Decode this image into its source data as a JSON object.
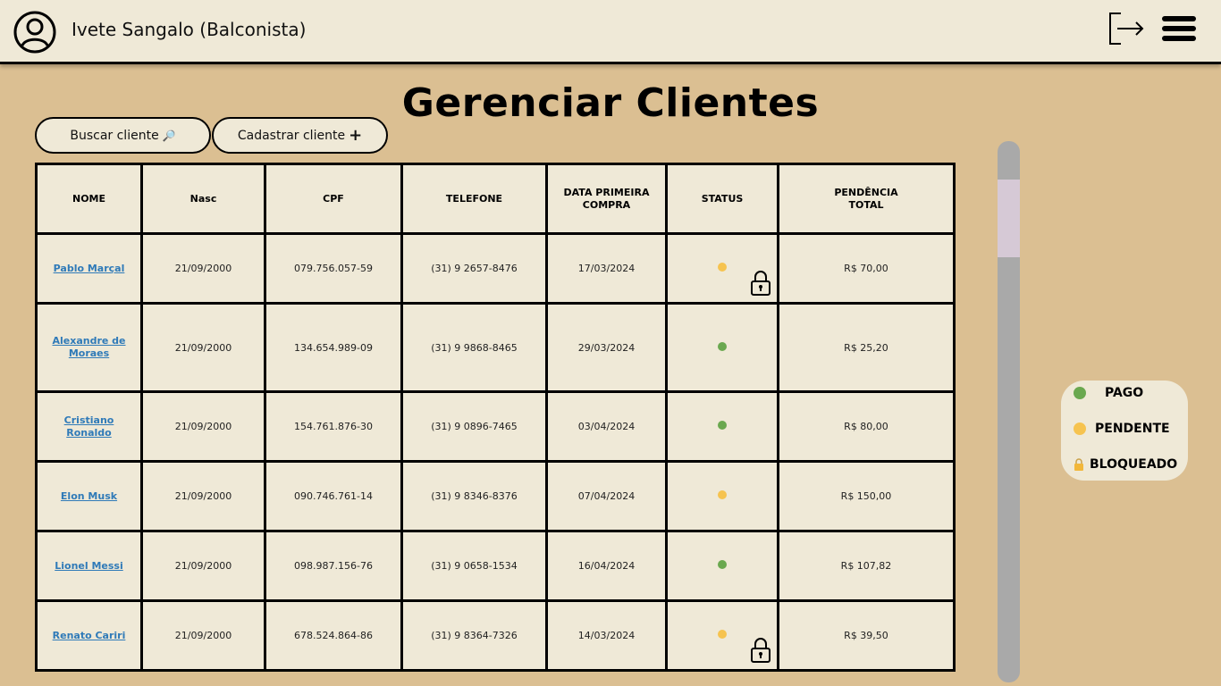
{
  "header": {
    "user_name": "Ivete Sangalo (Balconista)",
    "avatar_icon": "user-circle-icon",
    "logout_icon": "logout-icon",
    "menu_icon": "hamburger-menu-icon"
  },
  "page": {
    "title": "Gerenciar Clientes"
  },
  "actions": {
    "search_label": "Buscar cliente",
    "search_icon": "🔎",
    "add_label": "Cadastrar cliente",
    "add_icon": "+"
  },
  "table": {
    "columns": {
      "nome": "NOME",
      "nasc": "Nasc",
      "cpf": "CPF",
      "telefone": "TELEFONE",
      "data_compra_1": "DATA PRIMEIRA",
      "data_compra_2": "COMPRA",
      "status": "STATUS",
      "pendencia_1": "PENDÊNCIA",
      "pendencia_2": "TOTAL"
    },
    "rows": [
      {
        "nome_1": "Pablo Marçal",
        "nome_2": "",
        "nasc": "21/09/2000",
        "cpf": "079.756.057-59",
        "telefone": "(31) 9 2657-8476",
        "data": "17/03/2024",
        "status": "pendente",
        "bloqueado": true,
        "pendencia": "R$ 70,00"
      },
      {
        "nome_1": "Alexandre de",
        "nome_2": "Moraes",
        "nasc": "21/09/2000",
        "cpf": "134.654.989-09",
        "telefone": "(31) 9 9868-8465",
        "data": "29/03/2024",
        "status": "pago",
        "bloqueado": false,
        "pendencia": "R$ 25,20"
      },
      {
        "nome_1": "Cristiano",
        "nome_2": "Ronaldo",
        "nasc": "21/09/2000",
        "cpf": "154.761.876-30",
        "telefone": "(31) 9 0896-7465",
        "data": "03/04/2024",
        "status": "pago",
        "bloqueado": false,
        "pendencia": "R$ 80,00"
      },
      {
        "nome_1": "Elon Musk",
        "nome_2": "",
        "nasc": "21/09/2000",
        "cpf": "090.746.761-14",
        "telefone": "(31) 9 8346-8376",
        "data": "07/04/2024",
        "status": "pendente",
        "bloqueado": false,
        "pendencia": "R$ 150,00"
      },
      {
        "nome_1": "Lionel Messi",
        "nome_2": "",
        "nasc": "21/09/2000",
        "cpf": "098.987.156-76",
        "telefone": "(31) 9 0658-1534",
        "data": "16/04/2024",
        "status": "pago",
        "bloqueado": false,
        "pendencia": "R$ 107,82"
      },
      {
        "nome_1": "Renato Cariri",
        "nome_2": "",
        "nasc": "21/09/2000",
        "cpf": "678.524.864-86",
        "telefone": "(31) 9 8364-7326",
        "data": "14/03/2024",
        "status": "pendente",
        "bloqueado": true,
        "pendencia": "R$ 39,50"
      }
    ]
  },
  "legend": {
    "pago": "PAGO",
    "pendente": "PENDENTE",
    "bloqueado": "BLOQUEADO",
    "colors": {
      "pago": "#6aa84f",
      "pendente": "#f6c34f"
    }
  }
}
